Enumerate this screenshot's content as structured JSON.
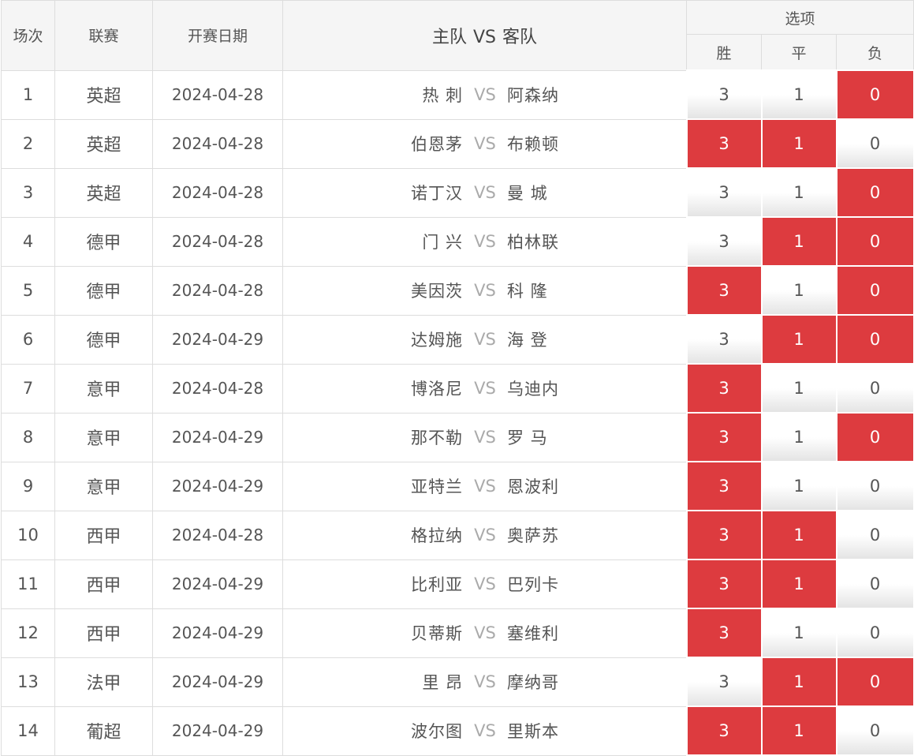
{
  "header": {
    "index": "场次",
    "league": "联赛",
    "date": "开赛日期",
    "home": "主队",
    "vs": "VS",
    "away": "客队",
    "options": "选项",
    "win": "胜",
    "draw": "平",
    "loss": "负"
  },
  "colors": {
    "selected": "#dd3b3f",
    "border": "#dddddd",
    "header_bg": "#f5f5f5"
  },
  "vs_label": "VS",
  "matches": [
    {
      "no": "1",
      "league": "英超",
      "date": "2024-04-28",
      "home": "热 刺",
      "away": "阿森纳",
      "win": "3",
      "draw": "1",
      "loss": "0",
      "picks": {
        "win": false,
        "draw": false,
        "loss": true
      }
    },
    {
      "no": "2",
      "league": "英超",
      "date": "2024-04-28",
      "home": "伯恩茅",
      "away": "布赖顿",
      "win": "3",
      "draw": "1",
      "loss": "0",
      "picks": {
        "win": true,
        "draw": true,
        "loss": false
      }
    },
    {
      "no": "3",
      "league": "英超",
      "date": "2024-04-28",
      "home": "诺丁汉",
      "away": "曼 城",
      "win": "3",
      "draw": "1",
      "loss": "0",
      "picks": {
        "win": false,
        "draw": false,
        "loss": true
      }
    },
    {
      "no": "4",
      "league": "德甲",
      "date": "2024-04-28",
      "home": "门 兴",
      "away": "柏林联",
      "win": "3",
      "draw": "1",
      "loss": "0",
      "picks": {
        "win": false,
        "draw": true,
        "loss": true
      }
    },
    {
      "no": "5",
      "league": "德甲",
      "date": "2024-04-28",
      "home": "美因茨",
      "away": "科 隆",
      "win": "3",
      "draw": "1",
      "loss": "0",
      "picks": {
        "win": true,
        "draw": false,
        "loss": true
      }
    },
    {
      "no": "6",
      "league": "德甲",
      "date": "2024-04-29",
      "home": "达姆施",
      "away": "海 登",
      "win": "3",
      "draw": "1",
      "loss": "0",
      "picks": {
        "win": false,
        "draw": true,
        "loss": true
      }
    },
    {
      "no": "7",
      "league": "意甲",
      "date": "2024-04-28",
      "home": "博洛尼",
      "away": "乌迪内",
      "win": "3",
      "draw": "1",
      "loss": "0",
      "picks": {
        "win": true,
        "draw": false,
        "loss": false
      }
    },
    {
      "no": "8",
      "league": "意甲",
      "date": "2024-04-29",
      "home": "那不勒",
      "away": "罗 马",
      "win": "3",
      "draw": "1",
      "loss": "0",
      "picks": {
        "win": true,
        "draw": false,
        "loss": true
      }
    },
    {
      "no": "9",
      "league": "意甲",
      "date": "2024-04-29",
      "home": "亚特兰",
      "away": "恩波利",
      "win": "3",
      "draw": "1",
      "loss": "0",
      "picks": {
        "win": true,
        "draw": false,
        "loss": false
      }
    },
    {
      "no": "10",
      "league": "西甲",
      "date": "2024-04-28",
      "home": "格拉纳",
      "away": "奥萨苏",
      "win": "3",
      "draw": "1",
      "loss": "0",
      "picks": {
        "win": true,
        "draw": true,
        "loss": false
      }
    },
    {
      "no": "11",
      "league": "西甲",
      "date": "2024-04-29",
      "home": "比利亚",
      "away": "巴列卡",
      "win": "3",
      "draw": "1",
      "loss": "0",
      "picks": {
        "win": true,
        "draw": true,
        "loss": false
      }
    },
    {
      "no": "12",
      "league": "西甲",
      "date": "2024-04-29",
      "home": "贝蒂斯",
      "away": "塞维利",
      "win": "3",
      "draw": "1",
      "loss": "0",
      "picks": {
        "win": true,
        "draw": false,
        "loss": false
      }
    },
    {
      "no": "13",
      "league": "法甲",
      "date": "2024-04-29",
      "home": "里 昂",
      "away": "摩纳哥",
      "win": "3",
      "draw": "1",
      "loss": "0",
      "picks": {
        "win": false,
        "draw": true,
        "loss": true
      }
    },
    {
      "no": "14",
      "league": "葡超",
      "date": "2024-04-29",
      "home": "波尔图",
      "away": "里斯本",
      "win": "3",
      "draw": "1",
      "loss": "0",
      "picks": {
        "win": true,
        "draw": true,
        "loss": false
      }
    }
  ]
}
